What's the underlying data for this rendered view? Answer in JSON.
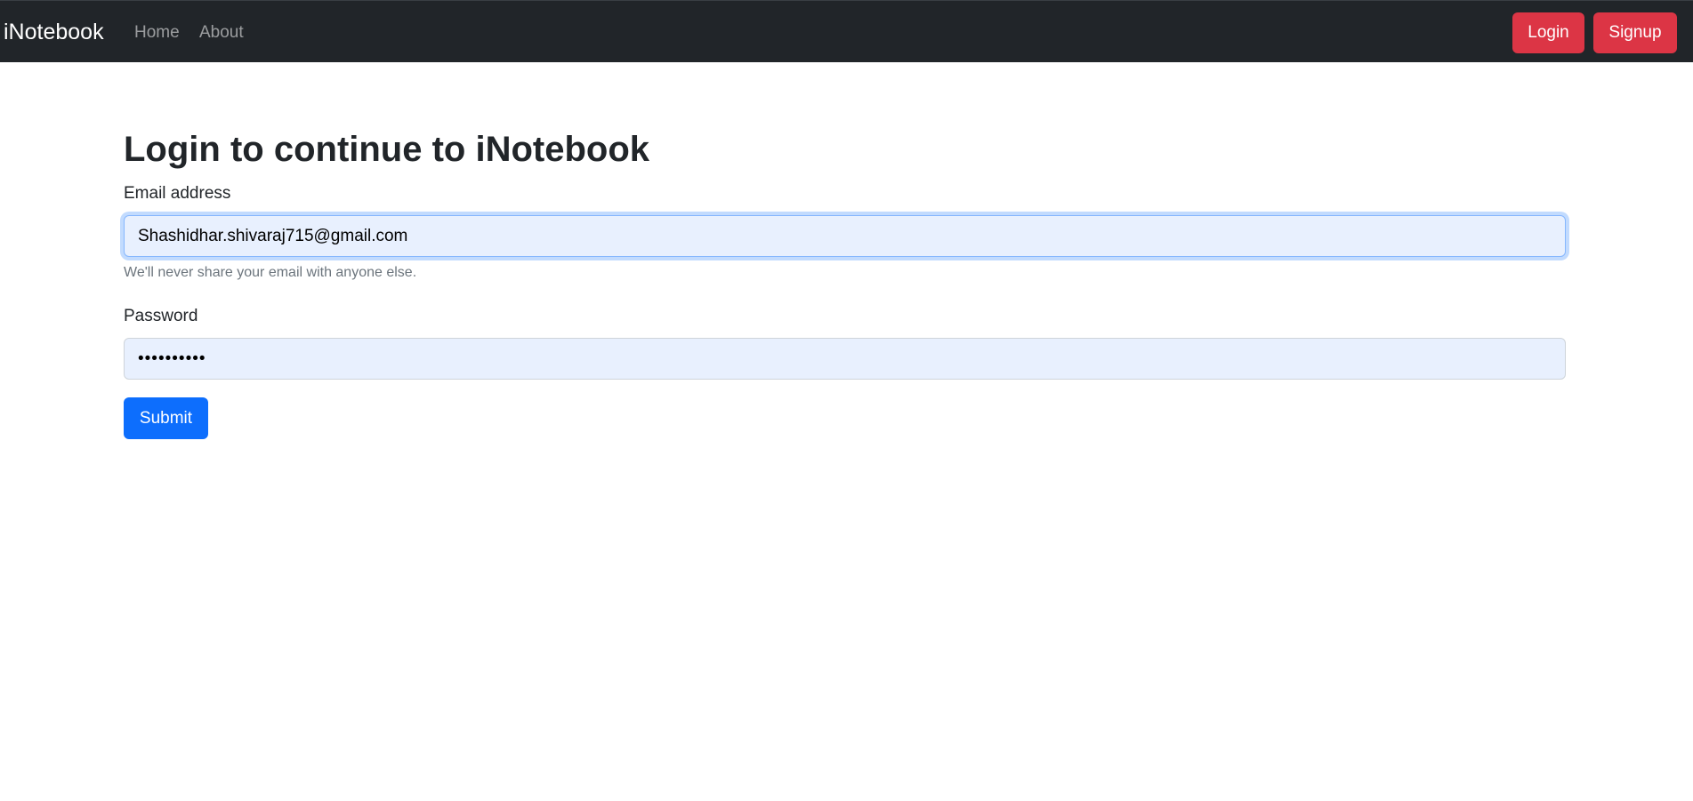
{
  "navbar": {
    "brand": "iNotebook",
    "links": [
      {
        "label": "Home"
      },
      {
        "label": "About"
      }
    ],
    "login_label": "Login",
    "signup_label": "Signup"
  },
  "main": {
    "title": "Login to continue to iNotebook",
    "email": {
      "label": "Email address",
      "value": "Shashidhar.shivaraj715@gmail.com",
      "help_text": "We'll never share your email with anyone else."
    },
    "password": {
      "label": "Password",
      "value": "••••••••••"
    },
    "submit_label": "Submit"
  },
  "colors": {
    "navbar_bg": "#212529",
    "danger": "#dc3545",
    "primary": "#0d6efd",
    "autofill_bg": "#e8f0fe"
  }
}
